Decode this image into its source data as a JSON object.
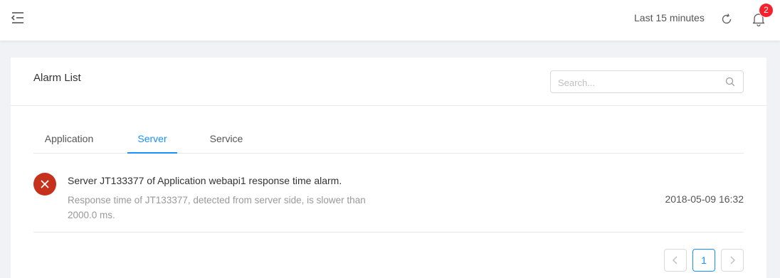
{
  "header": {
    "time_range": "Last 15 minutes",
    "notification_count": "2",
    "icons": [
      "menu-fold-icon",
      "refresh-icon",
      "bell-icon"
    ]
  },
  "card": {
    "title": "Alarm List",
    "search": {
      "placeholder": "Search...",
      "value": ""
    }
  },
  "tabs": [
    {
      "label": "Application",
      "active": false
    },
    {
      "label": "Server",
      "active": true
    },
    {
      "label": "Service",
      "active": false
    }
  ],
  "alarms": [
    {
      "title": "Server JT133377 of Application webapi1 response time alarm.",
      "description": "Response time of JT133377, detected from server side, is slower than 2000.0 ms.",
      "time": "2018-05-09 16:32",
      "status_color": "#c6311c",
      "icon": "close-icon"
    }
  ],
  "pagination": {
    "current": "1"
  },
  "colors": {
    "accent": "#1890ff",
    "badge": "#f5222d",
    "alarm": "#c6311c"
  }
}
